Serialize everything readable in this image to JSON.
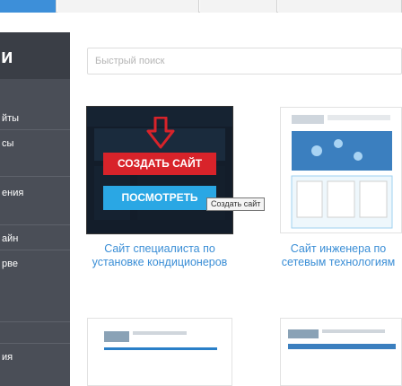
{
  "top_tabs": [
    {
      "label": "",
      "active": true
    },
    {
      "label": "",
      "active": false
    },
    {
      "label": "",
      "active": false
    },
    {
      "label": "",
      "active": false
    }
  ],
  "sidebar": {
    "header": "и",
    "items": [
      {
        "label": "йты"
      },
      {
        "label": "сы"
      },
      {
        "label": "ения"
      },
      {
        "label": "айн"
      },
      {
        "label": "рве"
      },
      {
        "label": "ия"
      }
    ]
  },
  "search": {
    "placeholder": "Быстрый поиск",
    "value": ""
  },
  "cards": [
    {
      "title": "Сайт специалиста по установке кондиционеров",
      "hover": true,
      "create_label": "СОЗДАТЬ САЙТ",
      "view_label": "ПОСМОТРЕТЬ",
      "tooltip": "Создать сайт"
    },
    {
      "title": "Сайт инженера по сетевым технологиям",
      "hover": false
    },
    {
      "title": "",
      "hover": false
    },
    {
      "title": "",
      "hover": false
    }
  ],
  "colors": {
    "accent": "#3d8fd9",
    "sidebar_bg": "#4a4e57",
    "create_button": "#d8232a",
    "view_button": "#2aa7e4",
    "link": "#3a8ed6"
  },
  "icons": {
    "arrow": "down-arrow-icon"
  }
}
